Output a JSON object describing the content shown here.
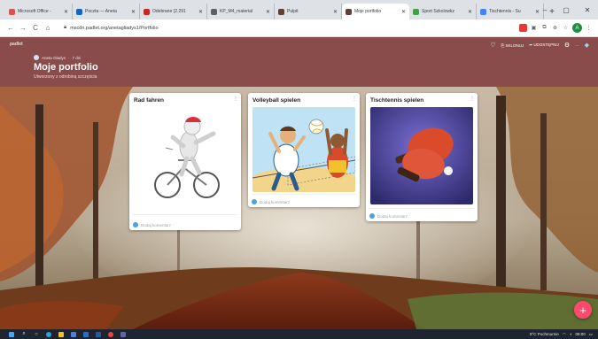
{
  "browser": {
    "tabs": [
      {
        "label": "Microsoft Office - ",
        "favicon_color": "#d9534f"
      },
      {
        "label": "Poczta — Aneta",
        "favicon_color": "#1565c0"
      },
      {
        "label": "Odebrane (2.291",
        "favicon_color": "#c62828"
      },
      {
        "label": "KP_M4_material",
        "favicon_color": "#616161"
      },
      {
        "label": "Pulpit",
        "favicon_color": "#5d4037"
      },
      {
        "label": "Moje portfolio",
        "favicon_color": "#5d4037",
        "active": true
      },
      {
        "label": "Sport Szkolowkz",
        "favicon_color": "#43a047"
      },
      {
        "label": "Tischtennis - Su",
        "favicon_color": "#4285f4"
      }
    ],
    "new_tab_label": "+",
    "window_controls": {
      "minimize": "‒",
      "maximize": "▢",
      "close": "✕"
    },
    "url": "mscdn.padlet.org/anetagliadys1/Portfolio",
    "nav": {
      "back": "←",
      "forward": "→",
      "reload": "C",
      "home": "⌂"
    },
    "profile_letter": "A"
  },
  "padlet": {
    "brand": "padlet",
    "author": "Aneta Gładys",
    "age": "7 dni",
    "title": "Moje portfolio",
    "subtitle": "Utworzony z odrobiną szczęścia",
    "actions": {
      "like_icon": "heart-icon",
      "remake_label": "SKLONUJ",
      "share_label": "UDOSTĘPNIJ",
      "settings_icon": "gear-icon",
      "more_label": "···"
    },
    "fab_label": "+",
    "accent": "#8a4c4a",
    "fab_color": "#ff4b6b"
  },
  "cards": [
    {
      "title": "Rad fahren",
      "comment_placeholder": "Dodaj komentarz",
      "image": "cyclist-figure"
    },
    {
      "title": "Volleyball spielen",
      "comment_placeholder": "Dodaj komentarz",
      "image": "volleyball-players"
    },
    {
      "title": "Tischtennis spielen",
      "comment_placeholder": "Dodaj komentarz",
      "image": "ping-pong-paddles"
    }
  ],
  "taskbar": {
    "search_label": "Wyszukiwanie",
    "tray_text": "9°C Pochmurnie",
    "clock": "08:00"
  }
}
